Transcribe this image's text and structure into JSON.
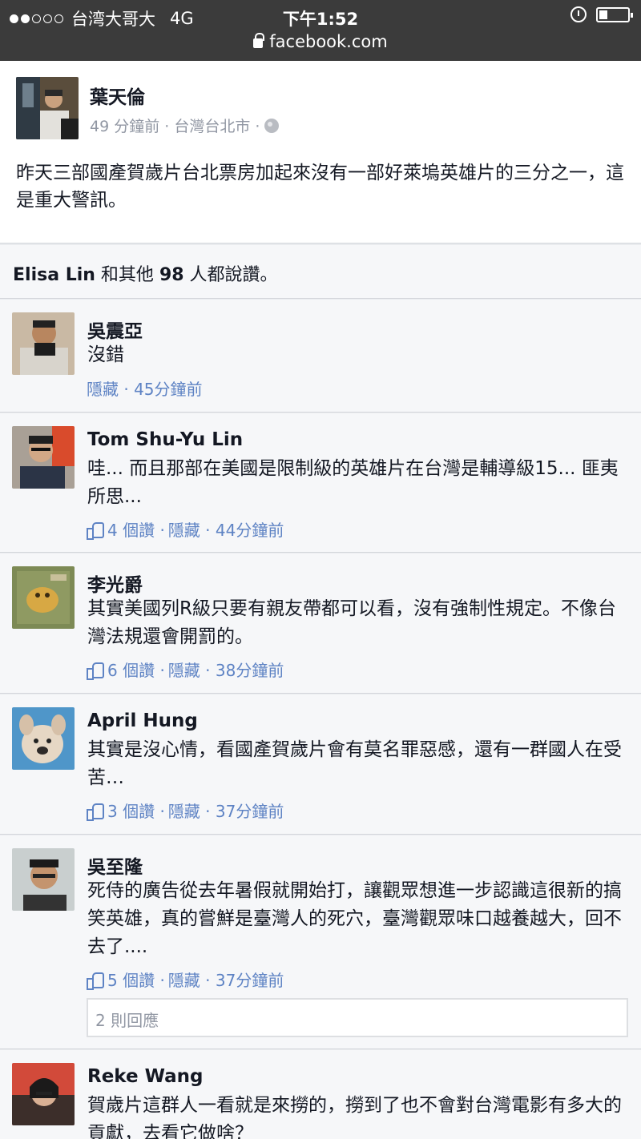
{
  "status_bar": {
    "carrier": "台湾大哥大",
    "network": "4G",
    "time": "下午1:52",
    "url": "facebook.com",
    "signal_full": 2,
    "signal_total": 5
  },
  "post": {
    "author": "葉天倫",
    "meta": "49 分鐘前 · 台灣台北市 ·",
    "text": "昨天三部國產賀歲片台北票房加起來沒有一部好萊塢英雄片的三分之一，這是重大警訊。",
    "privacy_icon": "globe-icon"
  },
  "likes": {
    "name": "Elisa Lin",
    "mid": " 和其他 ",
    "count": "98",
    "tail": " 人都說讚。"
  },
  "comments": [
    {
      "name": "吳震亞",
      "text": "沒錯",
      "likes": "",
      "actions": "隱藏 · 45分鐘前"
    },
    {
      "name": "Tom Shu-Yu Lin",
      "text": "哇... 而且那部在美國是限制級的英雄片在台灣是輔導級15... 匪夷所思...",
      "likes": "4 個讚 · ",
      "actions": "隱藏 · 44分鐘前"
    },
    {
      "name": "李光爵",
      "text": "其實美國列R級只要有親友帶都可以看，沒有強制性規定。不像台灣法規還會開罰的。",
      "likes": "6 個讚 · ",
      "actions": "隱藏 · 38分鐘前"
    },
    {
      "name": "April Hung",
      "text": "其實是沒心情，看國產賀歲片會有莫名罪惡感，還有一群國人在受苦…",
      "likes": "3 個讚 · ",
      "actions": "隱藏 · 37分鐘前"
    },
    {
      "name": "吳至隆",
      "text": "死侍的廣告從去年暑假就開始打，讓觀眾想進一步認識這很新的搞笑英雄，真的嘗鮮是臺灣人的死穴，臺灣觀眾味口越養越大，回不去了....",
      "likes": "5 個讚 · ",
      "actions": "隱藏 · 37分鐘前",
      "replies": "2 則回應"
    },
    {
      "name": "Reke Wang",
      "text": "賀歲片這群人一看就是來撈的，撈到了也不會對台灣電影有多大的貢獻，去看它做啥？"
    }
  ],
  "colors": {
    "link": "#5e83c4",
    "meta": "#9197a3",
    "bg": "#f6f7f9",
    "statusbar": "#3b3b3b"
  }
}
